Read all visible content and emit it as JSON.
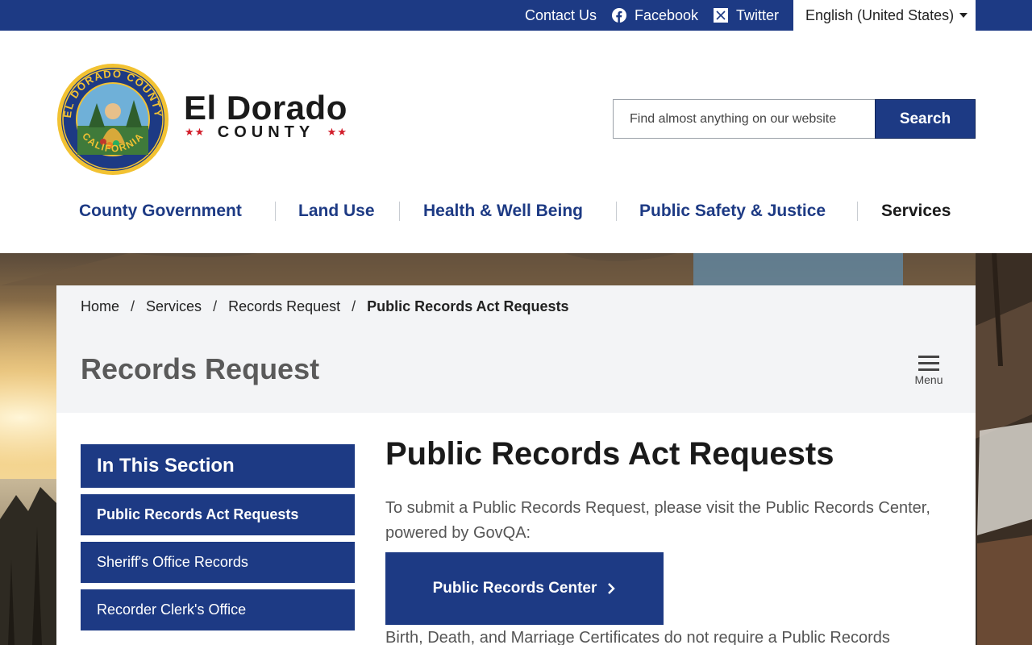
{
  "topbar": {
    "contact_label": "Contact Us",
    "facebook_label": "Facebook",
    "twitter_label": "Twitter",
    "language_selected": "English (United States)"
  },
  "header": {
    "brand_name": "El Dorado",
    "brand_sub": "COUNTY",
    "search_placeholder": "Find almost anything on our website",
    "search_button": "Search"
  },
  "nav": {
    "items": [
      {
        "label": "County Government"
      },
      {
        "label": "Land Use"
      },
      {
        "label": "Health & Well Being"
      },
      {
        "label": "Public Safety & Justice"
      },
      {
        "label": "Services"
      }
    ]
  },
  "breadcrumb": [
    "Home",
    "Services",
    "Records Request",
    "Public Records Act Requests"
  ],
  "section": {
    "title": "Records Request",
    "menu_label": "Menu"
  },
  "sidebar": {
    "heading": "In This Section",
    "items": [
      {
        "label": "Public Records Act Requests"
      },
      {
        "label": "Sheriff's Office Records"
      },
      {
        "label": "Recorder Clerk's Office"
      }
    ]
  },
  "article": {
    "title": "Public Records Act Requests",
    "intro": "To submit a Public Records Request, please visit the Public Records Center, powered by GovQA:",
    "cta_label": "Public Records Center",
    "followup": "Birth, Death, and Marriage Certificates do not require a Public Records"
  },
  "colors": {
    "brand_blue": "#1d3a84",
    "star_red": "#d21d2a",
    "panel_gray": "#f3f4f6"
  },
  "icons": [
    "facebook-icon",
    "twitter-x-icon",
    "chevron-down-icon",
    "hamburger-menu-icon",
    "chevron-right-icon"
  ]
}
